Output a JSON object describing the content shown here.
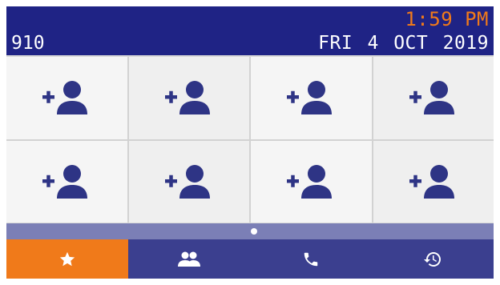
{
  "status_bar": {
    "time": "1:59 PM",
    "extension": "910",
    "date": "FRI 4 OCT 2019"
  },
  "favorites_grid": {
    "slots": [
      {
        "icon": "add-contact-icon"
      },
      {
        "icon": "add-contact-icon"
      },
      {
        "icon": "add-contact-icon"
      },
      {
        "icon": "add-contact-icon"
      },
      {
        "icon": "add-contact-icon"
      },
      {
        "icon": "add-contact-icon"
      },
      {
        "icon": "add-contact-icon"
      },
      {
        "icon": "add-contact-icon"
      }
    ]
  },
  "pager": {
    "pages": 1,
    "current": 1
  },
  "tabs": [
    {
      "icon": "star-icon",
      "active": true
    },
    {
      "icon": "contacts-icon",
      "active": false
    },
    {
      "icon": "phone-icon",
      "active": false
    },
    {
      "icon": "history-icon",
      "active": false
    }
  ],
  "colors": {
    "status_bar_bg": "#1f2385",
    "time_color": "#f07a1a",
    "accent": "#f07a1a",
    "icon_color": "#2e3485",
    "tabbar_bg": "#3b3f8f",
    "pager_bg": "#7b7fb6"
  }
}
